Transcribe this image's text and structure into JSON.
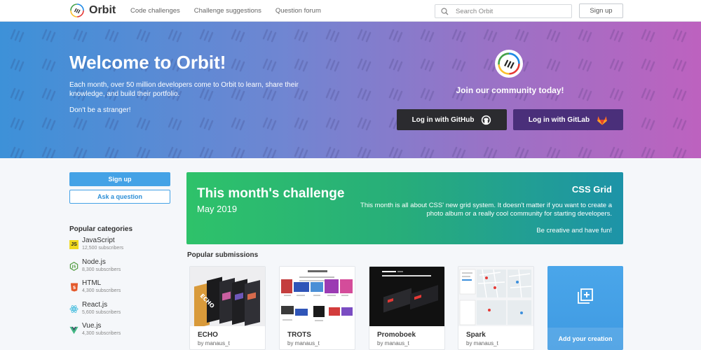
{
  "brand": {
    "name": "Orbit"
  },
  "nav": {
    "links": [
      "Code challenges",
      "Challenge suggestions",
      "Question forum"
    ],
    "search_placeholder": "Search Orbit",
    "signup_label": "Sign up"
  },
  "hero": {
    "title": "Welcome to Orbit!",
    "text": "Each month, over 50 million developers come to Orbit to learn, share their knowledge, and build their portfolio.",
    "subtext": "Don't be a stranger!",
    "join_text": "Join our community today!",
    "github_label": "Log in with GitHub",
    "gitlab_label": "Log in with GitLab"
  },
  "sidebar": {
    "signup_label": "Sign up",
    "ask_label": "Ask a question",
    "categories_title": "Popular categories",
    "categories": [
      {
        "name": "JavaScript",
        "subs": "12,500 subscribers",
        "icon": "javascript-icon",
        "color": "#f0d91d"
      },
      {
        "name": "Node.js",
        "subs": "8,300 subscribers",
        "icon": "nodejs-icon",
        "color": "#5aa14a"
      },
      {
        "name": "HTML",
        "subs": "4,300 subscribers",
        "icon": "html5-icon",
        "color": "#e45a2c"
      },
      {
        "name": "React.js",
        "subs": "5,600 subscribers",
        "icon": "react-icon",
        "color": "#39b9dc"
      },
      {
        "name": "Vue.js",
        "subs": "4,300 subscribers",
        "icon": "vue-icon",
        "color": "#41b883"
      }
    ]
  },
  "challenge": {
    "title": "This month's challenge",
    "date": "May 2019",
    "topic": "CSS Grid",
    "description": "This month is all about CSS' new grid system. It doesn't matter if you want to create a photo album or a really cool community for starting developers.",
    "cta": "Be creative and have fun!"
  },
  "submissions": {
    "title": "Popular submissions",
    "items": [
      {
        "name": "ECHO",
        "author": "by manaus_t"
      },
      {
        "name": "TROTS",
        "author": "by manaus_t"
      },
      {
        "name": "Promoboek",
        "author": "by manaus_t"
      },
      {
        "name": "Spark",
        "author": "by manaus_t"
      }
    ],
    "add_label": "Add your creation"
  },
  "colors": {
    "accent": "#44a2e6",
    "github": "#2b2b2f",
    "gitlab": "#4a2f7a",
    "challenge_start": "#2ec26a",
    "challenge_end": "#1d93a8"
  }
}
